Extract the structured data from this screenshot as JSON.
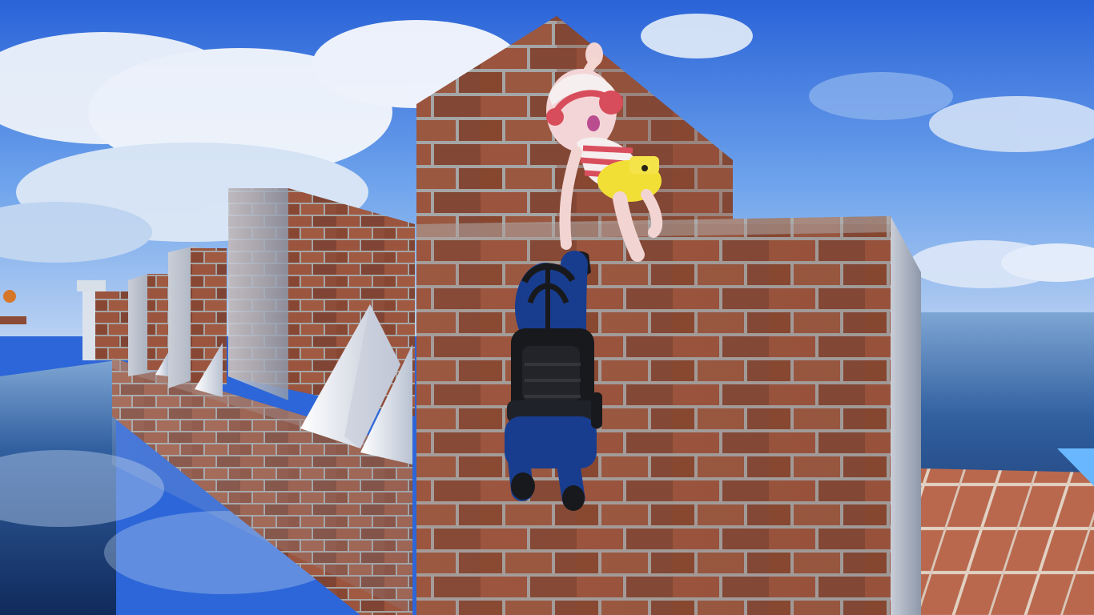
{
  "scene": {
    "type": "game",
    "hud_text": []
  },
  "colors": {
    "sky_top": "#2a63d8",
    "sky_mid": "#6fa4ec",
    "sky_low": "#b9d1f2",
    "cloud": "#f2f5fb",
    "water_dark": "#102a5b",
    "water_mid": "#315f9f",
    "water_light": "#8db3df",
    "brick": "#8d4d39",
    "brick_dark": "#6f3b2d",
    "brick_light": "#a55d45",
    "mortar": "#a3a3a3",
    "spike": "#e7ebf5",
    "spike_shadow": "#b4bccb",
    "floor_tile": "#b9684e",
    "floor_line": "#e1d1c2",
    "player_blue": "#183d8f",
    "player_black": "#18191c",
    "companion_white": "#f5e7e6",
    "companion_red": "#d84d5b",
    "companion_yellow": "#f1df35"
  },
  "characters": [
    {
      "name": "blue-armored-character",
      "icon": "armored-climber"
    },
    {
      "name": "pink-haired-companion",
      "icon": "headphones-character"
    }
  ],
  "objects": {
    "spikes": 4,
    "ocean": true,
    "brick_walls": true,
    "tile_floor": true
  }
}
